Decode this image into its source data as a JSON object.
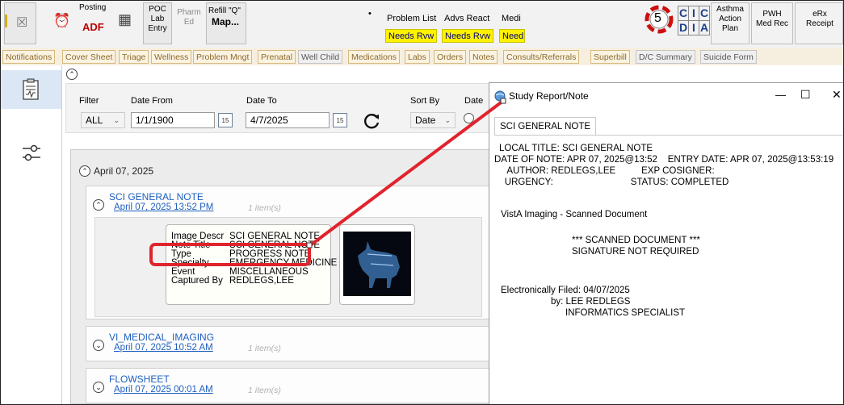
{
  "toolbar": {
    "posting_label": "Posting",
    "adf_label": "ADF",
    "poc_lab_entry": [
      "POC",
      "Lab",
      "Entry"
    ],
    "pharm_ed": [
      "Pharm",
      "Ed"
    ],
    "refill_q": "Refill \"Q\"",
    "map_label": "Map...",
    "problem_list_label": "Problem List",
    "adv_react_label": "Advs React",
    "medi_label": "Medi",
    "needs_rvw_1": "Needs Rvw",
    "needs_rvw_2": "Needs Rvw",
    "needs_rvw_3": "Need",
    "badge_count": "5",
    "cida_letters": [
      "C",
      "I",
      "C",
      "D",
      "I",
      "A"
    ],
    "asthma_plan": [
      "Asthma",
      "Action",
      "Plan"
    ],
    "pwh_med_rec": [
      "PWH",
      "Med Rec"
    ],
    "erx_receipt": [
      "eRx",
      "Receipt"
    ]
  },
  "tabs": [
    "Notifications",
    "Cover Sheet",
    "Triage",
    "Wellness",
    "Problem Mngt",
    "Prenatal",
    "Well Child",
    "Medications",
    "Labs",
    "Orders",
    "Notes",
    "Consults/Referrals",
    "Superbill",
    "D/C Summary",
    "Suicide Form"
  ],
  "filter": {
    "filter_label": "Filter",
    "filter_value": "ALL",
    "date_from_label": "Date From",
    "date_from_value": "1/1/1900",
    "date_to_label": "Date To",
    "date_to_value": "4/7/2025",
    "sort_by_label": "Sort By",
    "sort_by_value": "Date",
    "date_label2": "Date",
    "cal_day": "15"
  },
  "results": {
    "date_header": "April 07, 2025",
    "notes": [
      {
        "title": "SCI GENERAL NOTE",
        "date": "April 07, 2025 13:52 PM",
        "items": "1 item(s)"
      },
      {
        "title": "VI_MEDICAL_IMAGING",
        "date": "April 07, 2025 10:52 AM",
        "items": "1 item(s)"
      },
      {
        "title": "FLOWSHEET",
        "date": "April 07, 2025 00:01 AM",
        "items": "1 item(s)"
      }
    ],
    "details": [
      {
        "key": "Image Descr",
        "value": "SCI GENERAL NOTE"
      },
      {
        "key": "Note Title",
        "value": "SCI GENERAL NOTE"
      },
      {
        "key": "Type",
        "value": "PROGRESS NOTE"
      },
      {
        "key": "Specialty",
        "value": "EMERGENCY MEDICINE"
      },
      {
        "key": "Event",
        "value": "MISCELLANEOUS"
      },
      {
        "key": "Captured By",
        "value": "REDLEGS,LEE"
      }
    ]
  },
  "dialog": {
    "title": "Study Report/Note",
    "minimize": "—",
    "maximize": "☐",
    "close": "✕",
    "tab": "SCI GENERAL NOTE",
    "lines": [
      "LOCAL TITLE: SCI GENERAL NOTE",
      "DATE OF NOTE: APR 07, 2025@13:52    ENTRY DATE: APR 07, 2025@13:53:19",
      "     AUTHOR: REDLEGS,LEE          EXP COSIGNER:",
      "    URGENCY:                              STATUS: COMPLETED",
      "VistA Imaging - Scanned Document",
      "*** SCANNED DOCUMENT ***",
      "SIGNATURE NOT REQUIRED",
      "Electronically Filed: 04/07/2025",
      "by: LEE REDLEGS",
      "INFORMATICS SPECIALIST"
    ]
  },
  "colors": {
    "accent_red": "#e0242c",
    "link_blue": "#1f5fbf",
    "needs_yellow": "#fff200",
    "tab_tan": "#8a6a2e"
  }
}
